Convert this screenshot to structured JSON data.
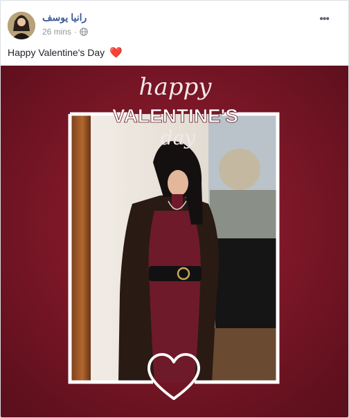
{
  "post": {
    "author": "رانيا يوسف",
    "timestamp": "26 mins",
    "separator": "·",
    "privacy_icon": "globe-icon",
    "options_icon": "ellipsis-icon",
    "text": "Happy Valentine's Day",
    "emoji": "❤️"
  },
  "image": {
    "script_top": "happy",
    "headline": "VALENTINE'S",
    "script_bottom": "day",
    "frame_icon": "heart-outline-icon",
    "colors": {
      "background": "#8a1a2c",
      "background_dark": "#5c0f1c",
      "frame": "#ffffff",
      "dress": "#6e1a2a",
      "fur": "#2a1a14"
    }
  }
}
